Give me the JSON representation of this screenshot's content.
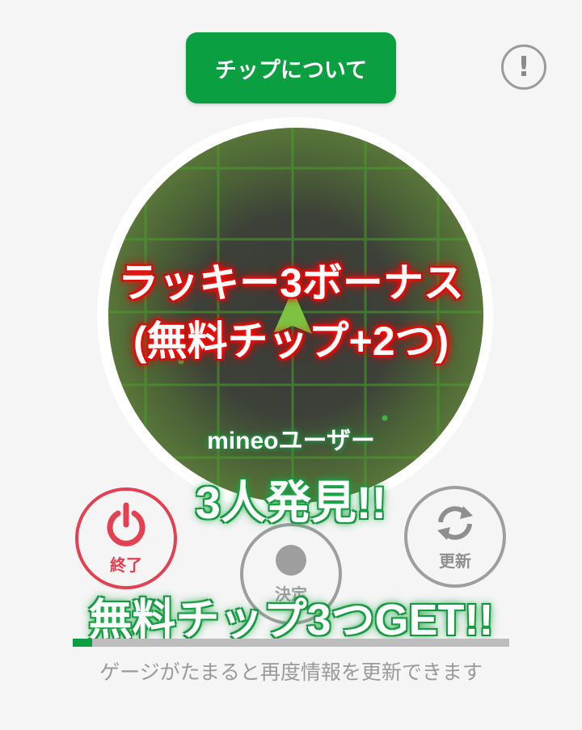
{
  "header": {
    "chip_button_label": "チップについて",
    "info_icon": "exclamation-circle-icon",
    "info_glyph": "!"
  },
  "radar": {
    "bonus_line1": "ラッキー3ボーナス",
    "bonus_line2": "(無料チップ+2つ)",
    "user_label": "mineoユーザー",
    "found_text": "3人発見!!"
  },
  "controls": {
    "end_label": "終了",
    "end_icon": "power-icon",
    "decide_label": "決定",
    "decide_icon": "record-dot-icon",
    "refresh_label": "更新",
    "refresh_icon": "refresh-icon"
  },
  "result": {
    "get_text": "無料チップ3つGET!!"
  },
  "gauge": {
    "fill_fraction": 0.045,
    "caption": "ゲージがたまると再度情報を更新できます"
  },
  "colors": {
    "brand_green": "#0aa041",
    "end_red": "#e34152",
    "gray": "#9e9e9e"
  }
}
